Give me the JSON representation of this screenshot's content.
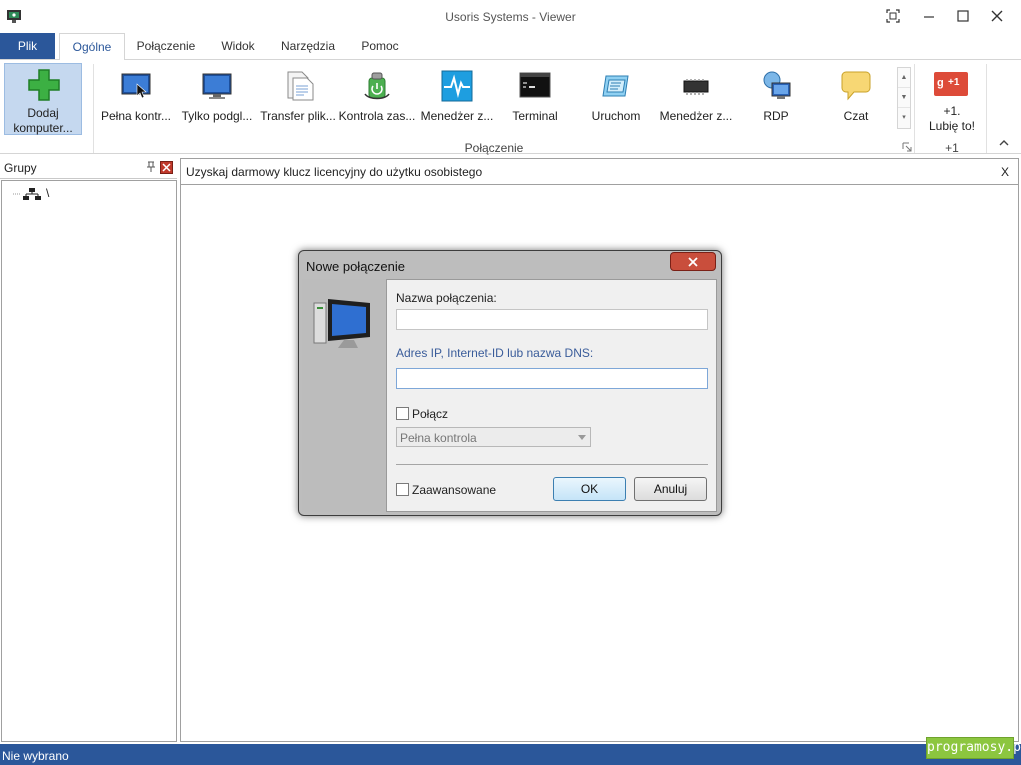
{
  "window": {
    "title": "Usoris Systems - Viewer"
  },
  "tabs": {
    "file": "Plik",
    "items": [
      {
        "label": "Ogólne",
        "active": true
      },
      {
        "label": "Połączenie",
        "active": false
      },
      {
        "label": "Widok",
        "active": false
      },
      {
        "label": "Narzędzia",
        "active": false
      },
      {
        "label": "Pomoc",
        "active": false
      }
    ]
  },
  "ribbon": {
    "add_computer": {
      "line1": "Dodaj",
      "line2": "komputer..."
    },
    "connection_items": [
      {
        "label": "Pełna kontr...",
        "icon": "monitor-full-control-icon"
      },
      {
        "label": "Tylko podgl...",
        "icon": "monitor-view-only-icon"
      },
      {
        "label": "Transfer plik...",
        "icon": "file-transfer-icon"
      },
      {
        "label": "Kontrola zas...",
        "icon": "power-control-icon"
      },
      {
        "label": "Menedżer z...",
        "icon": "task-manager-icon"
      },
      {
        "label": "Terminal",
        "icon": "terminal-icon"
      },
      {
        "label": "Uruchom",
        "icon": "run-icon"
      },
      {
        "label": "Menedżer z...",
        "icon": "device-manager-chip-icon"
      },
      {
        "label": "RDP",
        "icon": "rdp-icon"
      },
      {
        "label": "Czat",
        "icon": "chat-bubble-icon"
      }
    ],
    "connection_group_label": "Połączenie",
    "gplus": {
      "badge": "+1",
      "line1": "+1.",
      "line2": "Lubię to!",
      "group_label": "+1"
    }
  },
  "groups_panel": {
    "title": "Grupy",
    "tree_root": "\\"
  },
  "notice": {
    "text": "Uzyskaj darmowy klucz licencyjny do użytku osobistego",
    "close": "X"
  },
  "status": {
    "text": "Nie wybrano",
    "watermark": "programosy.pl"
  },
  "dialog": {
    "title": "Nowe połączenie",
    "name_label": "Nazwa połączenia:",
    "name_value": "",
    "address_label": "Adres IP, Internet-ID lub nazwa DNS:",
    "address_value": "",
    "connect_label": "Połącz",
    "connect_checked": false,
    "mode_selected": "Pełna kontrola",
    "advanced_label": "Zaawansowane",
    "advanced_checked": false,
    "ok_label": "OK",
    "cancel_label": "Anuluj"
  },
  "colors": {
    "accent": "#2b579a",
    "ribbon_selected": "#c5d8ef",
    "dialog_close": "#c94e3c",
    "gplus": "#dd4b39"
  }
}
